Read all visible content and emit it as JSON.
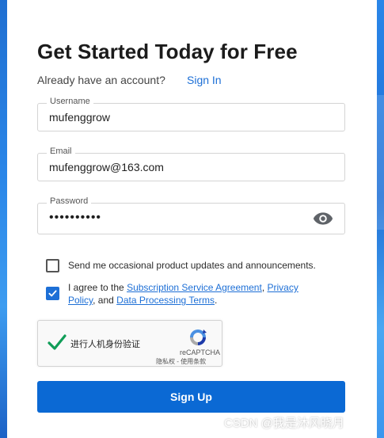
{
  "form": {
    "title": "Get Started Today for Free",
    "already_text": "Already have an account?",
    "signin_label": "Sign In",
    "username": {
      "label": "Username",
      "value": "mufenggrow"
    },
    "email": {
      "label": "Email",
      "value": "mufenggrow@163.com"
    },
    "password": {
      "label": "Password",
      "value": "••••••••••",
      "icon": "eye-icon"
    },
    "checkbox_updates": {
      "checked": false,
      "label": "Send me occasional product updates and announcements."
    },
    "checkbox_agree": {
      "checked": true,
      "prefix": "I agree to the ",
      "link1": "Subscription Service Agreement",
      "sep1": ", ",
      "link2": "Privacy Policy",
      "sep2": ", and ",
      "link3": "Data Processing Terms",
      "suffix": "."
    },
    "signup_label": "Sign Up"
  },
  "recaptcha": {
    "label": "进行人机身份验证",
    "brand": "reCAPTCHA",
    "terms": "隐私权 - 使用条款",
    "checked": true
  },
  "watermark": "CSDN @我是沐风晓月",
  "colors": {
    "accent": "#1d6fd6",
    "button": "#0b69d4",
    "check_green": "#109d58"
  }
}
